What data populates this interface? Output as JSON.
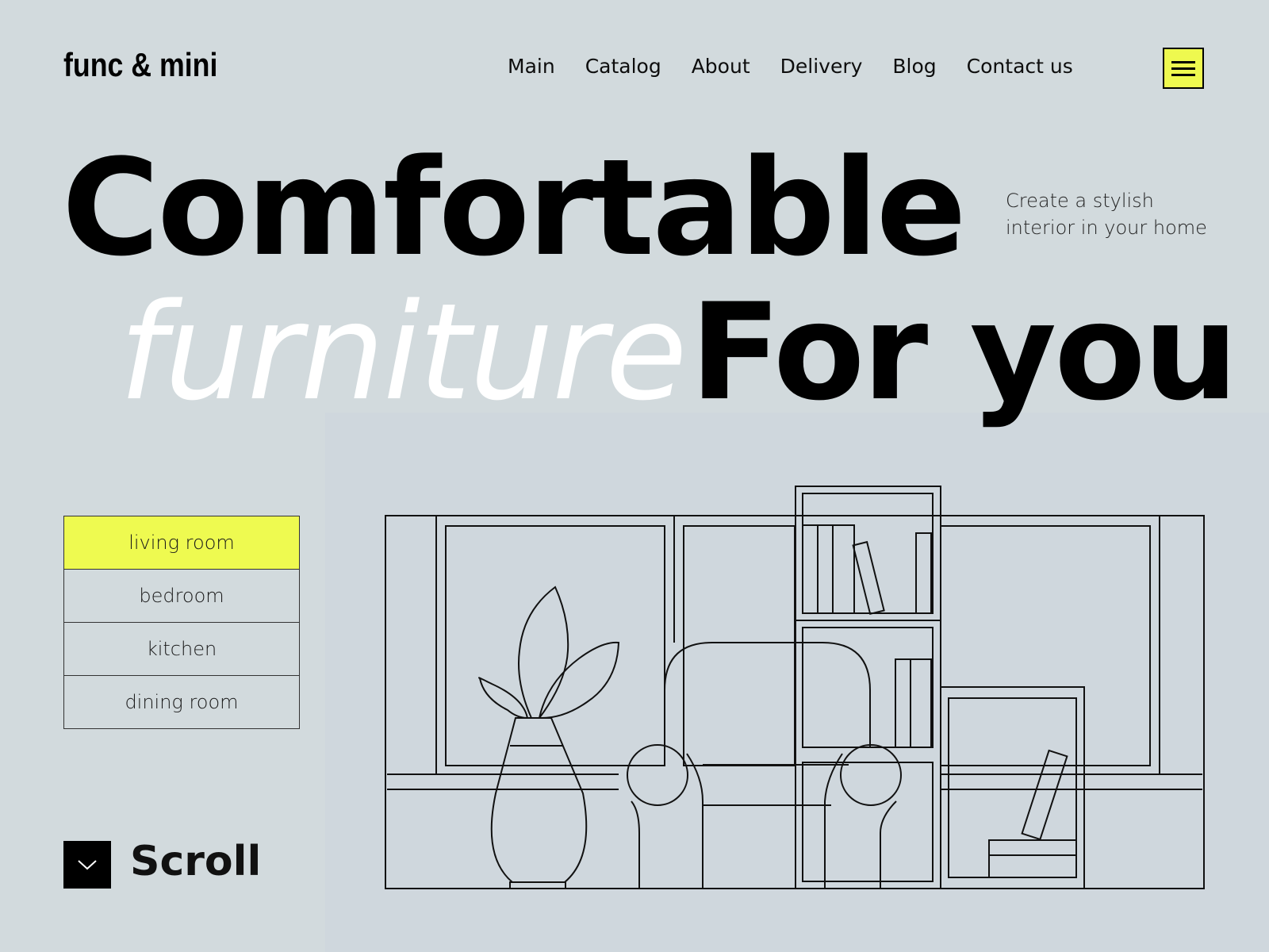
{
  "brand": {
    "logo": "func & mini"
  },
  "nav": {
    "items": [
      {
        "label": "Main"
      },
      {
        "label": "Catalog"
      },
      {
        "label": "About"
      },
      {
        "label": "Delivery"
      },
      {
        "label": "Blog"
      },
      {
        "label": "Contact us"
      }
    ],
    "menu_icon": "hamburger-icon"
  },
  "hero": {
    "line1": "Comfortable",
    "line2_light": "furniture",
    "line2_bold": "For you",
    "tagline_line1": "Create a stylish",
    "tagline_line2": "interior in your home"
  },
  "categories": {
    "items": [
      {
        "label": "living room",
        "active": true
      },
      {
        "label": "bedroom",
        "active": false
      },
      {
        "label": "kitchen",
        "active": false
      },
      {
        "label": "dining room",
        "active": false
      }
    ]
  },
  "scroll": {
    "label": "Scroll",
    "icon": "chevron-down-icon"
  },
  "illustration": {
    "subject": "line-art living room with windows, bookshelves, armchair and vase with leaves"
  },
  "colors": {
    "background": "#d2dadd",
    "accent": "#eefa50",
    "text": "#0d0d0d",
    "highlight_text": "#ffffff"
  }
}
